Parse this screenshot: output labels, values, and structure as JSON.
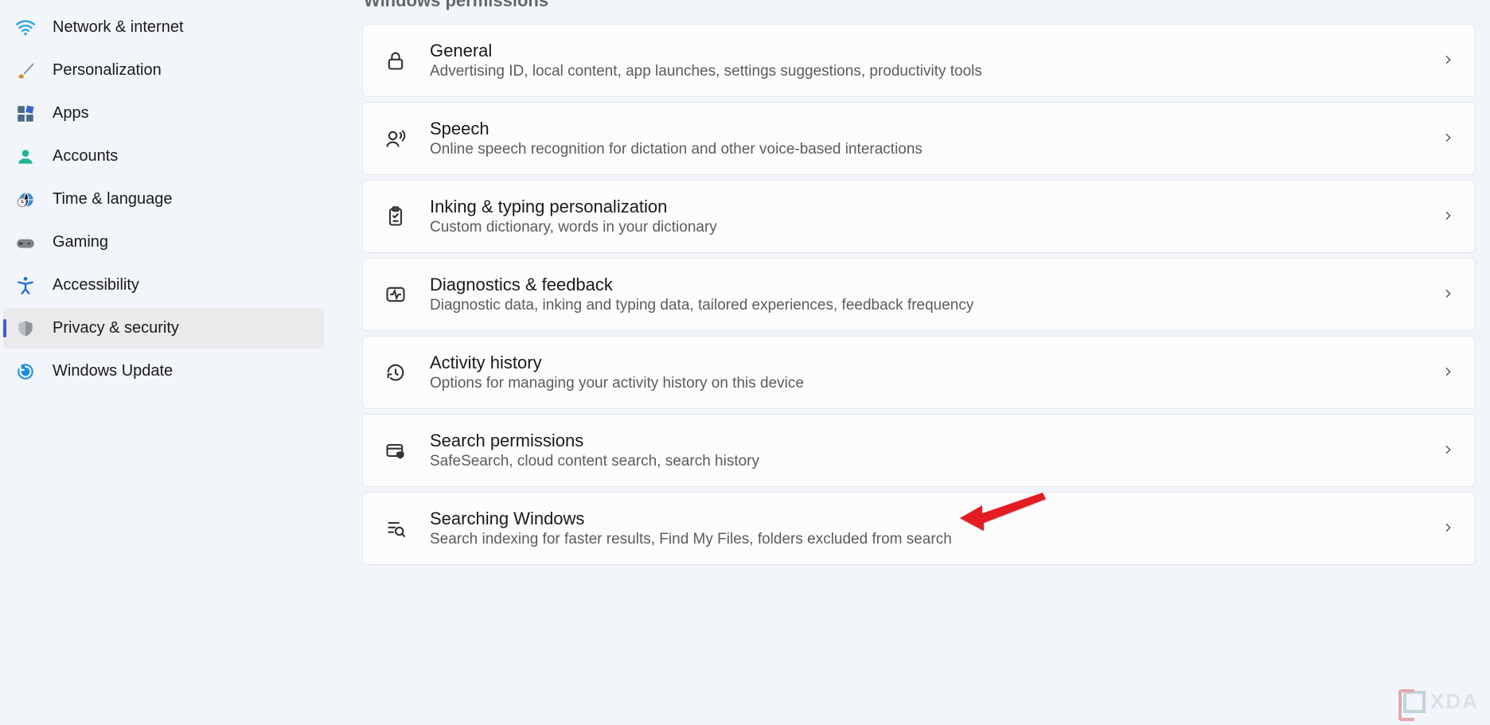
{
  "sidebar": {
    "items": [
      {
        "label": "Network & internet",
        "active": false
      },
      {
        "label": "Personalization",
        "active": false
      },
      {
        "label": "Apps",
        "active": false
      },
      {
        "label": "Accounts",
        "active": false
      },
      {
        "label": "Time & language",
        "active": false
      },
      {
        "label": "Gaming",
        "active": false
      },
      {
        "label": "Accessibility",
        "active": false
      },
      {
        "label": "Privacy & security",
        "active": true
      },
      {
        "label": "Windows Update",
        "active": false
      }
    ]
  },
  "main": {
    "section_heading": "Windows permissions",
    "cards": [
      {
        "title": "General",
        "sub": "Advertising ID, local content, app launches, settings suggestions, productivity tools"
      },
      {
        "title": "Speech",
        "sub": "Online speech recognition for dictation and other voice-based interactions"
      },
      {
        "title": "Inking & typing personalization",
        "sub": "Custom dictionary, words in your dictionary"
      },
      {
        "title": "Diagnostics & feedback",
        "sub": "Diagnostic data, inking and typing data, tailored experiences, feedback frequency"
      },
      {
        "title": "Activity history",
        "sub": "Options for managing your activity history on this device"
      },
      {
        "title": "Search permissions",
        "sub": "SafeSearch, cloud content search, search history"
      },
      {
        "title": "Searching Windows",
        "sub": "Search indexing for faster results, Find My Files, folders excluded from search"
      }
    ]
  },
  "watermark": "XDA"
}
